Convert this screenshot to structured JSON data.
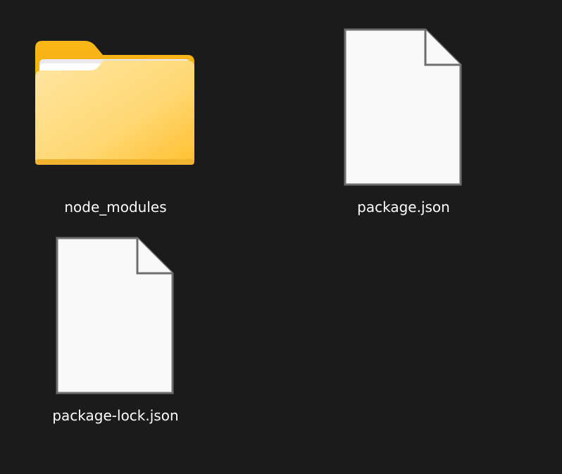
{
  "view": {
    "background": "#1b1b1b",
    "items": [
      {
        "name": "node_modules",
        "type": "folder",
        "icon": "folder-icon"
      },
      {
        "name": "package.json",
        "type": "file",
        "icon": "file-icon"
      },
      {
        "name": "package-lock.json",
        "type": "file",
        "icon": "file-icon"
      }
    ]
  },
  "colors": {
    "folder_back": "#f8b81b",
    "folder_front_light": "#ffe49a",
    "folder_front_dark": "#ffc83a",
    "file_fill": "#f9f9f9",
    "file_stroke": "#6e6e6e",
    "label_text": "#ffffff"
  }
}
